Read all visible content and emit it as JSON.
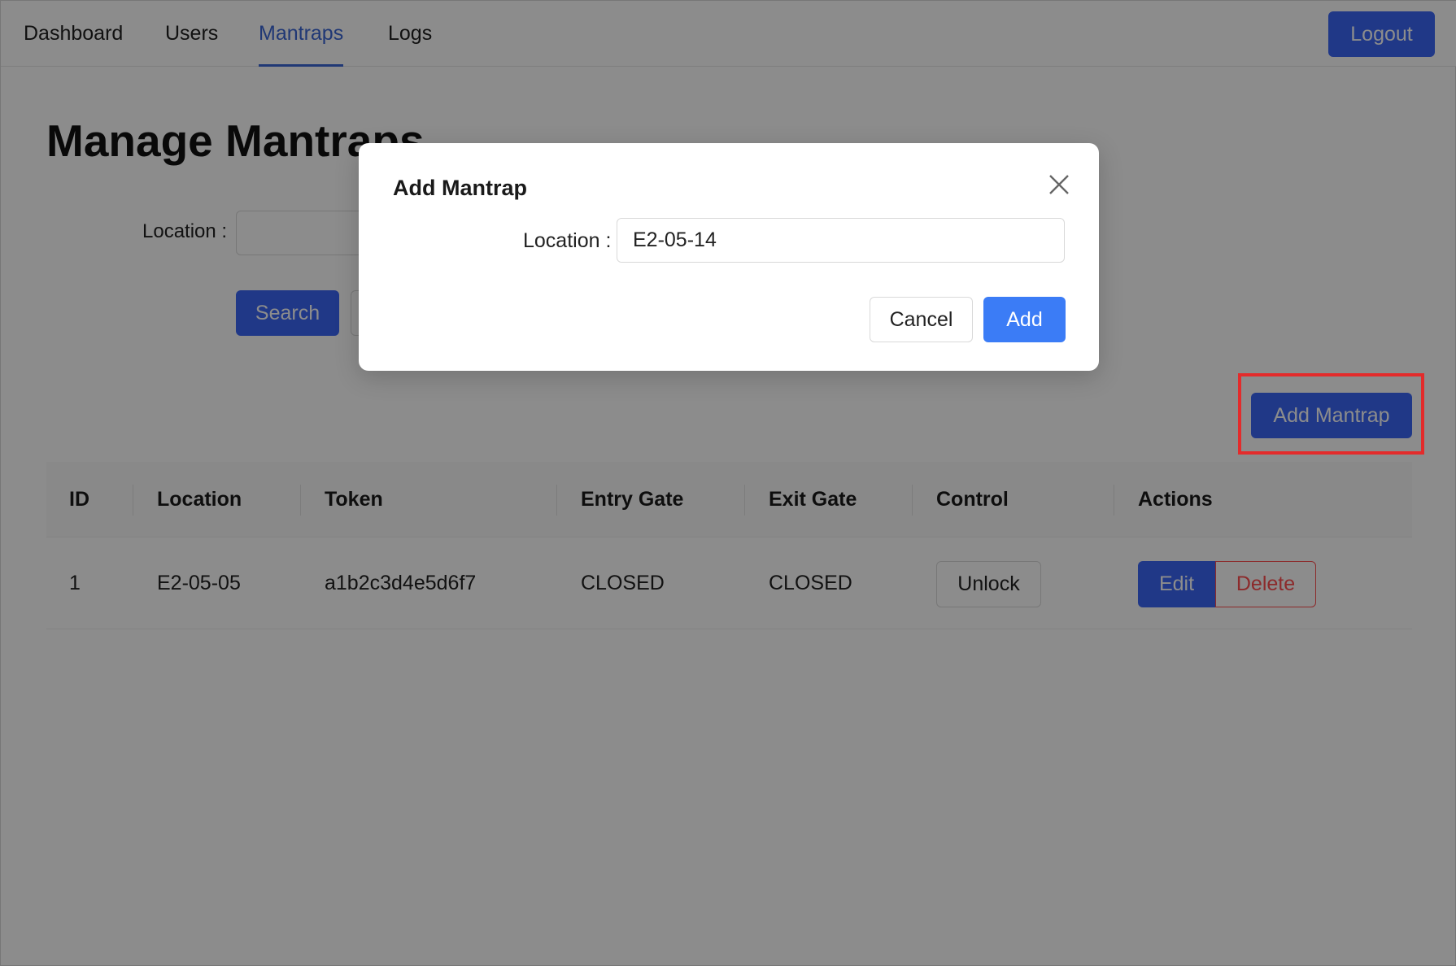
{
  "nav": {
    "items": [
      {
        "label": "Dashboard"
      },
      {
        "label": "Users"
      },
      {
        "label": "Mantraps"
      },
      {
        "label": "Logs"
      }
    ],
    "active": "Mantraps",
    "logout_label": "Logout"
  },
  "page": {
    "title": "Manage Mantraps",
    "search_label": "Location :",
    "search_value": "",
    "search_button": "Search",
    "reset_button": "",
    "add_button": "Add Mantrap"
  },
  "table": {
    "columns": [
      "ID",
      "Location",
      "Token",
      "Entry Gate",
      "Exit Gate",
      "Control",
      "Actions"
    ],
    "rows": [
      {
        "id": "1",
        "location": "E2-05-05",
        "token": "a1b2c3d4e5d6f7",
        "entry_gate": "CLOSED",
        "exit_gate": "CLOSED",
        "control_label": "Unlock",
        "edit_label": "Edit",
        "delete_label": "Delete"
      }
    ]
  },
  "modal": {
    "title": "Add Mantrap",
    "location_label": "Location :",
    "location_value": "E2-05-14",
    "cancel_label": "Cancel",
    "add_label": "Add"
  },
  "colors": {
    "primary": "#3b66f6",
    "danger": "#ff4d4f",
    "highlight": "#e32b2b",
    "active_nav": "#3b66d6"
  },
  "icons": {
    "modal_close": "close-icon"
  }
}
